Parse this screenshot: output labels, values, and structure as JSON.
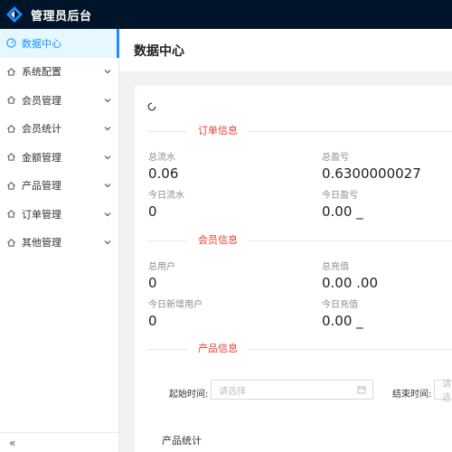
{
  "app": {
    "title": "管理员后台"
  },
  "sidebar": {
    "items": [
      {
        "label": "数据中心",
        "icon": "dashboard-icon",
        "active": true
      },
      {
        "label": "系统配置",
        "icon": "home-icon",
        "expandable": true
      },
      {
        "label": "会员管理",
        "icon": "home-icon",
        "expandable": true
      },
      {
        "label": "会员统计",
        "icon": "home-icon",
        "expandable": true
      },
      {
        "label": "金额管理",
        "icon": "home-icon",
        "expandable": true
      },
      {
        "label": "产品管理",
        "icon": "home-icon",
        "expandable": true
      },
      {
        "label": "订单管理",
        "icon": "home-icon",
        "expandable": true
      },
      {
        "label": "其他管理",
        "icon": "home-icon",
        "expandable": true
      }
    ],
    "collapse_glyph": "«"
  },
  "page": {
    "title": "数据中心"
  },
  "sections": {
    "orders": {
      "title": "订单信息",
      "total_flow_label": "总流水",
      "total_flow_value": "0.06",
      "total_profit_label": "总盈亏",
      "total_profit_value": "0.6300000027",
      "today_flow_label": "今日流水",
      "today_flow_value": "0",
      "today_profit_label": "今日盈亏",
      "today_profit_value": "0.00 _"
    },
    "members": {
      "title": "会员信息",
      "total_users_label": "总用户",
      "total_users_value": "0",
      "total_recharge_label": "总充值",
      "total_recharge_value": "0.00 .00",
      "new_users_label": "今日新增用户",
      "new_users_value": "0",
      "today_recharge_label": "今日充值",
      "today_recharge_value": "0.00 _"
    },
    "products": {
      "title": "产品信息",
      "start_label": "起始时间:",
      "start_placeholder": "请选择",
      "end_label": "结束时间:",
      "end_placeholder": "请选",
      "stats_heading": "产品统计"
    }
  },
  "colors": {
    "topbar": "#001529",
    "accent": "#1890ff",
    "section_title": "#e8402f"
  }
}
